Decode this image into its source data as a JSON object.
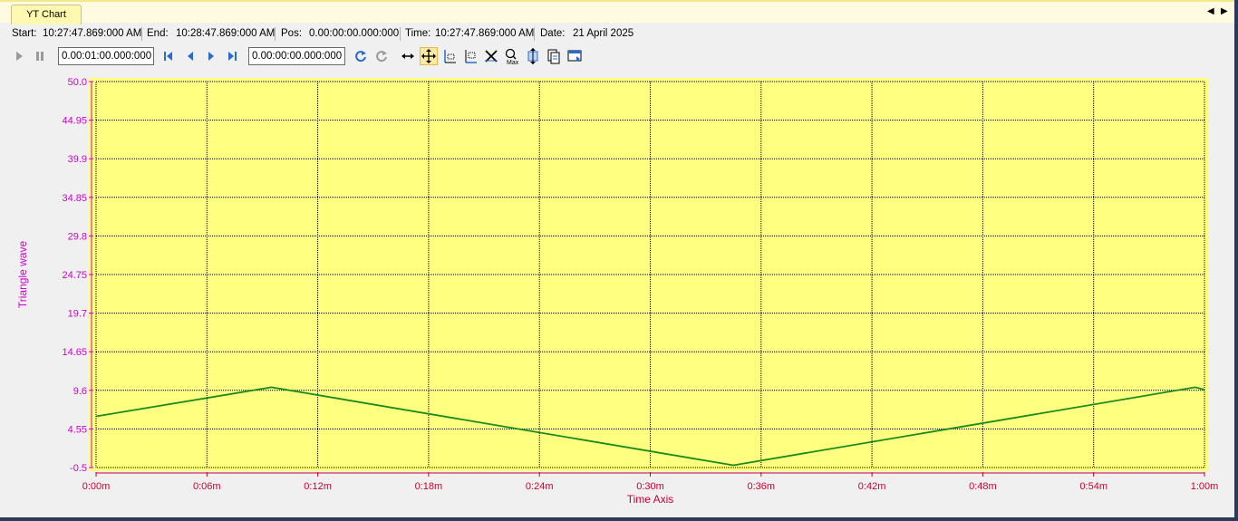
{
  "tab": {
    "label": "YT Chart",
    "prev_glyph": "◀",
    "next_glyph": "▶"
  },
  "info": {
    "start_label": "Start:",
    "start_value": "10:27:47.869:000 AM",
    "end_label": "End:",
    "end_value": "10:28:47.869:000 AM",
    "pos_label": "Pos:",
    "pos_value": "0.00:00:00.000:000",
    "time_label": "Time:",
    "time_value": "10:27:47.869:000 AM",
    "date_label": "Date:",
    "date_value": "21 April 2025"
  },
  "toolbar": {
    "display_width_value": "0.00:01:00.000:000",
    "position_value": "0.00:00:00.000:000",
    "icons": [
      "play-icon",
      "pause-icon",
      "first-icon",
      "prev-icon",
      "next-icon",
      "last-icon",
      "reset-icon",
      "redo-icon",
      "pan-icon",
      "move-icon",
      "zoom-x-icon",
      "zoom-y-icon",
      "delete-icon",
      "zoom-max-icon",
      "fit-icon",
      "copy-icon",
      "export-icon"
    ]
  },
  "colors": {
    "plot_background": "#ffff80",
    "axis_y": "#cc00cc",
    "axis_x": "#cc0033",
    "series": "#1a8a1a"
  },
  "chart_data": {
    "type": "line",
    "xlabel": "Time Axis",
    "ylabel": "Triangle wave",
    "xlim": [
      0,
      60
    ],
    "ylim": [
      -0.5,
      50.0
    ],
    "x_tick_labels": [
      "0:00m",
      "0:06m",
      "0:12m",
      "0:18m",
      "0:24m",
      "0:30m",
      "0:36m",
      "0:42m",
      "0:48m",
      "0:54m",
      "1:00m"
    ],
    "y_tick_labels": [
      "-0.5",
      "4.55",
      "9.6",
      "14.65",
      "19.7",
      "24.75",
      "29.8",
      "34.85",
      "39.9",
      "44.95",
      "50.0"
    ],
    "grid": true,
    "series": [
      {
        "x": [
          0,
          9.5,
          34.5,
          59.5,
          60
        ],
        "y": [
          6.2,
          10.0,
          -0.2,
          10.0,
          9.7
        ]
      }
    ]
  }
}
